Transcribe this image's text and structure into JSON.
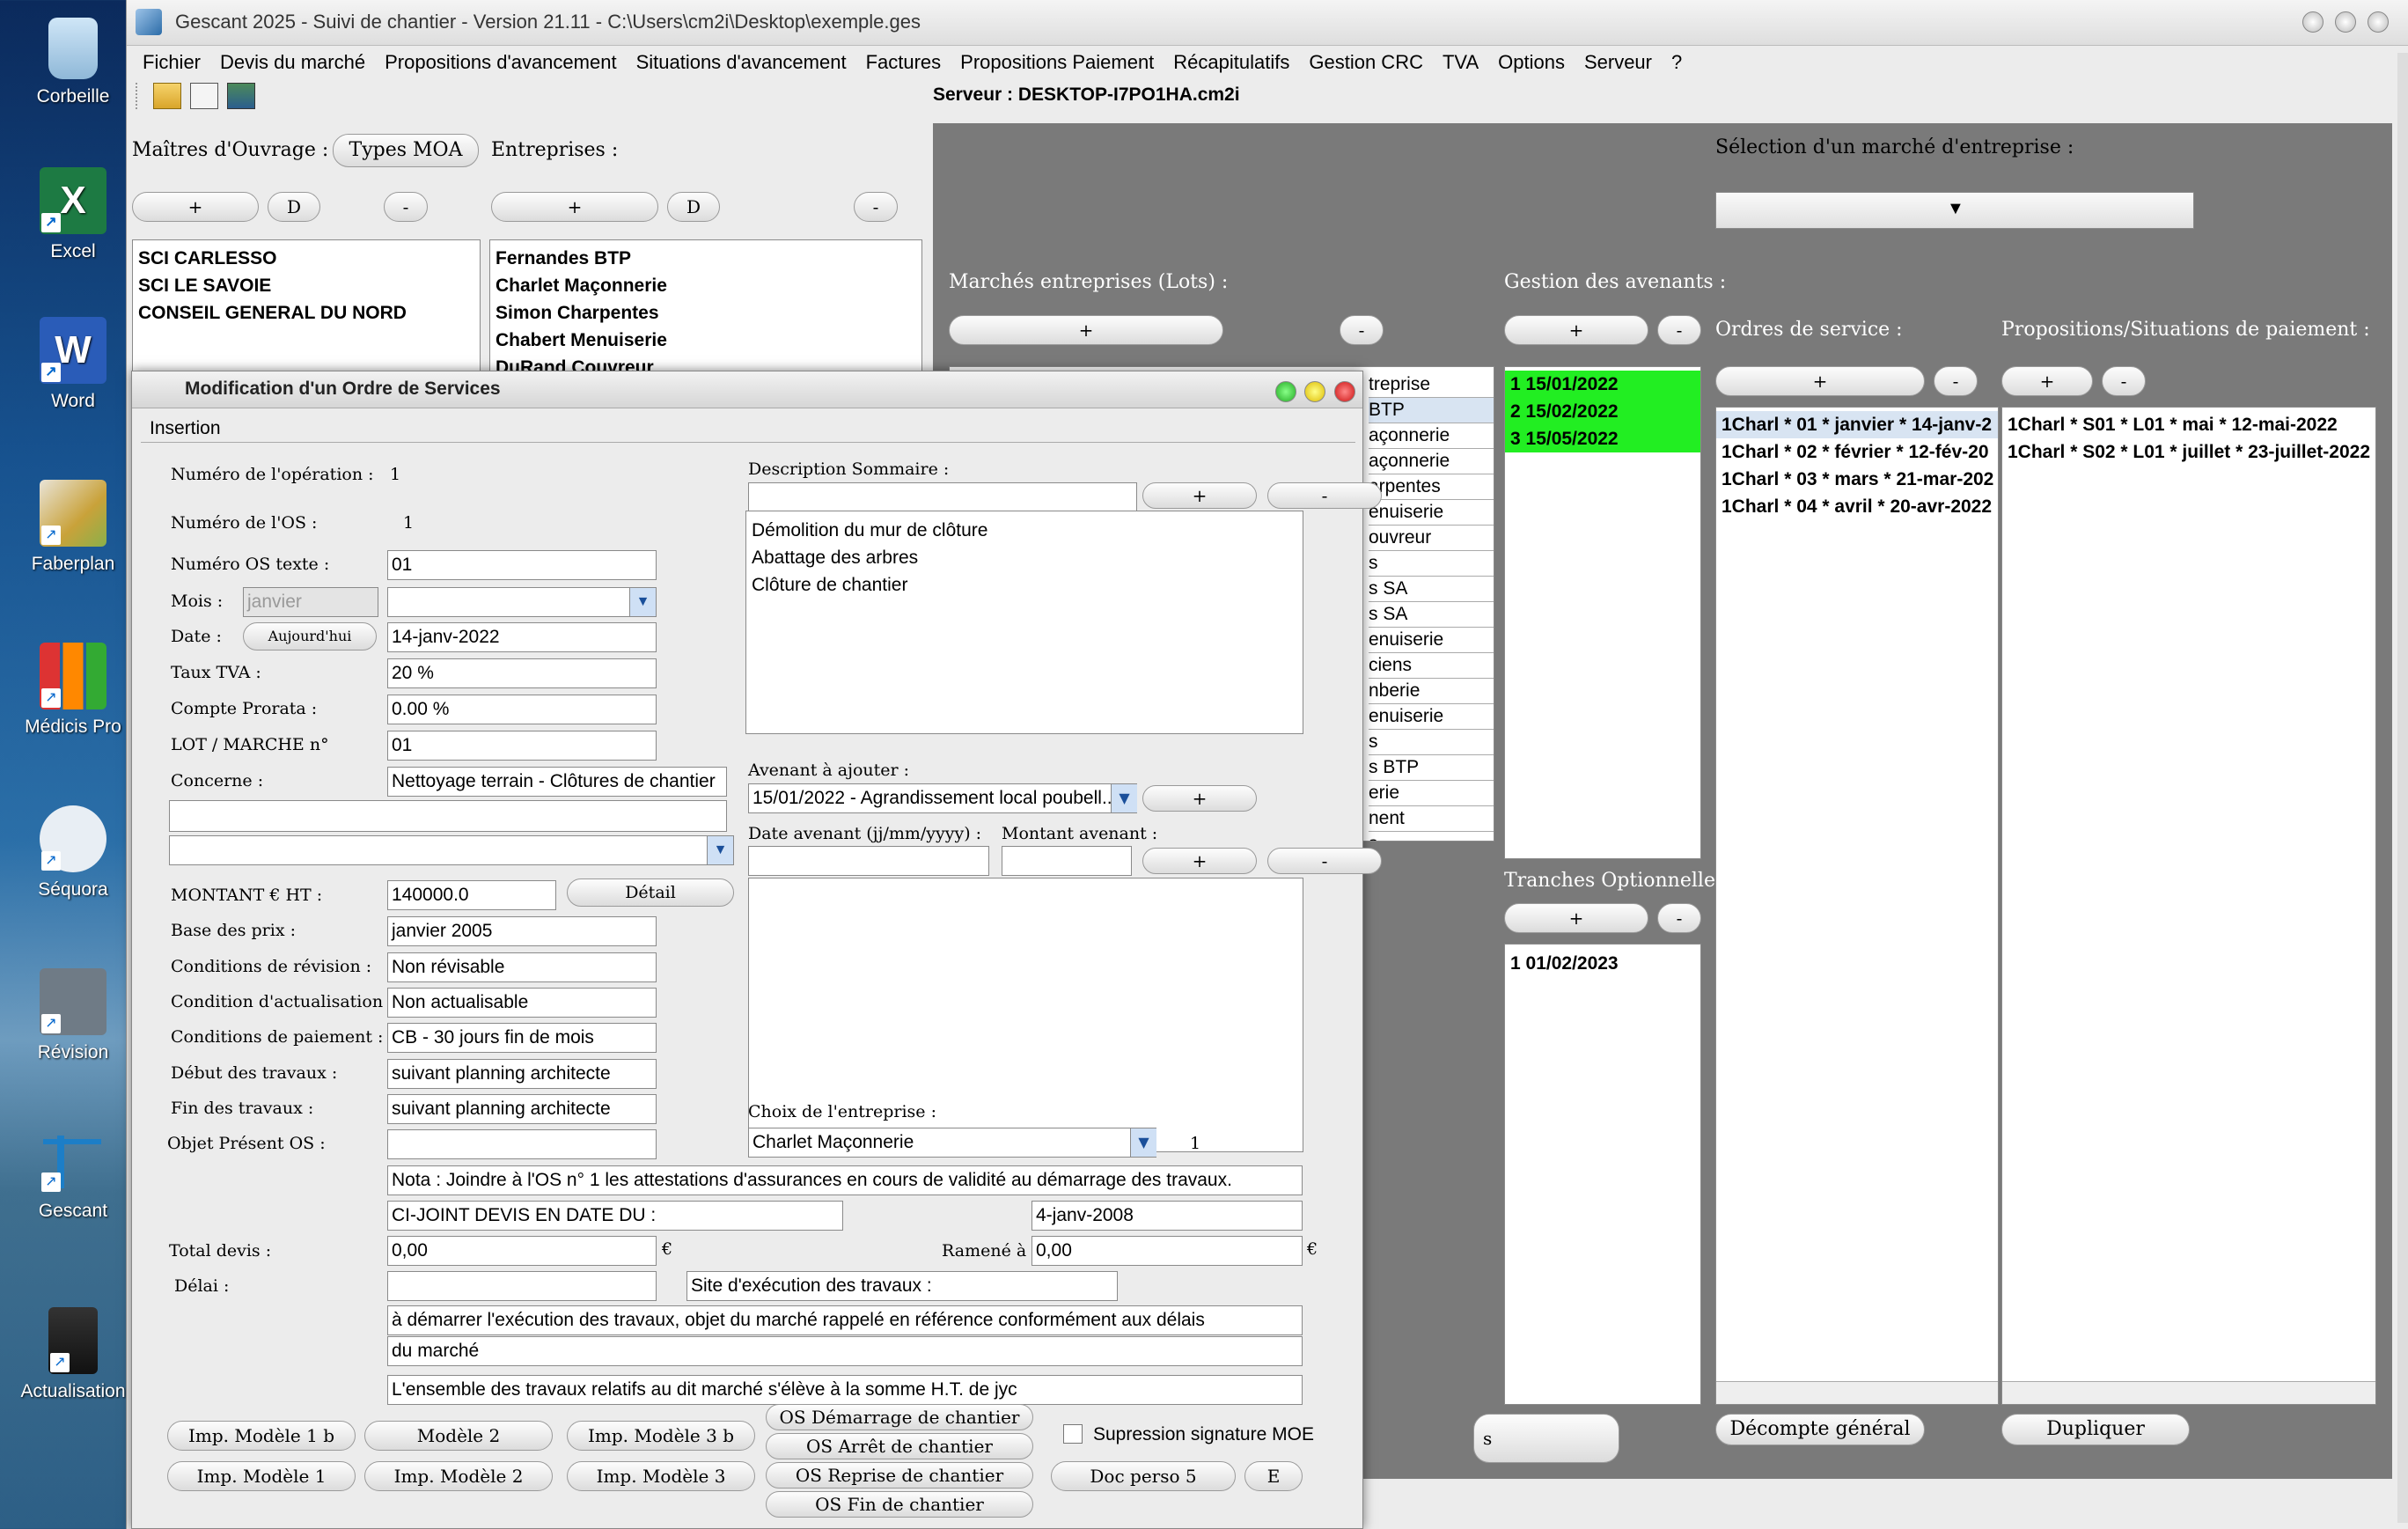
{
  "desktop": {
    "icons": [
      "Corbeille",
      "Excel",
      "Word",
      "Faberplan",
      "Médicis Pro",
      "Séquora",
      "Révision",
      "Gescant",
      "Actualisation"
    ]
  },
  "window": {
    "title": "Gescant 2025 - Suivi de chantier - Version 21.11 - C:\\Users\\cm2i\\Desktop\\exemple.ges",
    "server": "Serveur : DESKTOP-I7PO1HA.cm2i"
  },
  "menu": [
    "Fichier",
    "Devis du marché",
    "Propositions d'avancement",
    "Situations d'avancement",
    "Factures",
    "Propositions Paiement",
    "Récapitulatifs",
    "Gestion CRC",
    "TVA",
    "Options",
    "Serveur",
    "?"
  ],
  "left": {
    "moa_label": "Maîtres d'Ouvrage :",
    "types_moa": "Types MOA",
    "entreprises_label": "Entreprises :",
    "plus": "+",
    "d": "D",
    "minus": "-",
    "moa": [
      "SCI CARLESSO",
      "SCI LE SAVOIE",
      "CONSEIL GENERAL DU NORD"
    ],
    "entreprises": [
      "Fernandes BTP",
      "Charlet Maçonnerie",
      "Simon Charpentes",
      "Chabert Menuiserie",
      "DuRand Couvreur"
    ]
  },
  "right": {
    "selection_label": "Sélection d'un marché d'entreprise :",
    "marches_label": "Marchés entreprises (Lots) :",
    "avenants_label": "Gestion des avenants :",
    "os_label": "Ordres de service :",
    "props_label": "Propositions/Situations de paiement :",
    "tranches_label": "Tranches Optionnelles",
    "lots": [
      "treprise",
      " BTP",
      "açonnerie",
      "açonnerie",
      "arpentes",
      "enuiserie",
      "ouvreur",
      "s",
      "s SA",
      "s SA",
      "enuiserie",
      "ciens",
      "nberie",
      "enuiserie",
      "s",
      "s BTP",
      "erie",
      "nent",
      "s"
    ],
    "avenants": [
      "1 15/01/2022",
      "2 15/02/2022",
      "3 15/05/2022"
    ],
    "tranches": [
      "1 01/02/2023"
    ],
    "os": [
      "1Charl * 01 * janvier * 14-janv-2",
      "1Charl * 02 * février * 12-fév-20",
      "1Charl * 03 * mars * 21-mar-202",
      "1Charl * 04 * avril * 20-avr-2022"
    ],
    "props": [
      "1Charl * S01 * L01 * mai * 12-mai-2022",
      "1Charl * S02 * L01 * juillet * 23-juillet-2022"
    ],
    "decompte": "Décompte général",
    "dupliquer": "Dupliquer",
    "lot_btn_partial": "s"
  },
  "dialog": {
    "title": "Modification d'un Ordre de Services",
    "tab": "Insertion",
    "labels": {
      "num_op": "Numéro de l'opération :",
      "num_os": "Numéro de l'OS :",
      "num_os_txt": "Numéro OS texte :",
      "mois": "Mois :",
      "date": "Date :",
      "tva": "Taux TVA :",
      "prorata": "Compte Prorata :",
      "lot": "LOT / MARCHE n°",
      "concerne": "Concerne :",
      "montant": "MONTANT € HT :",
      "base": "Base des prix :",
      "revision": "Conditions de révision :",
      "actualisation": "Condition d'actualisation :",
      "paiement": "Conditions de paiement :",
      "debut": "Début des travaux :",
      "fin": "Fin des travaux :",
      "objet": "Objet Présent OS :",
      "total": "Total devis :",
      "ramene": "Ramené à :",
      "delai": "Délai :",
      "desc": "Description Sommaire :",
      "avenant": "Avenant à ajouter :",
      "date_av": "Date avenant (jj/mm/yyyy) :",
      "montant_av": "Montant avenant :",
      "choix": "Choix de l'entreprise :",
      "euro": "€",
      "site": "Site d'exécution des travaux :"
    },
    "values": {
      "num_op": "1",
      "num_os": "1",
      "num_os_txt": "01",
      "mois_placeholder": "janvier",
      "date": "14-janv-2022",
      "tva": "20 %",
      "prorata": "0.00 %",
      "lot": "01",
      "concerne": "Nettoyage terrain - Clôtures de chantier",
      "montant": "140000.0",
      "base": "janvier 2005",
      "revision": "Non révisable",
      "actualisation": "Non actualisable",
      "paiement": "CB - 30 jours fin de mois",
      "debut": "suivant planning architecte",
      "fin": "suivant planning architecte",
      "nota": "Nota : Joindre à l'OS n° 1 les attestations d'assurances en cours de validité au démarrage des travaux.",
      "cijoint": "CI-JOINT DEVIS EN DATE DU :",
      "cijoint_date": "4-janv-2008",
      "total": "0,00",
      "ramene": "0,00",
      "text1": "à démarrer l'exécution des travaux, objet du marché rappelé en référence conformément aux délais",
      "text2": "du marché",
      "text3": "L'ensemble des travaux relatifs au dit marché s'élève à la somme H.T. de jyc",
      "avenant": "15/01/2022 - Agrandissement local poubell...",
      "entreprise": "Charlet Maçonnerie",
      "entreprise_num": "1"
    },
    "desc_items": [
      "Démolition du mur de clôture",
      "Abattage des arbres",
      "Clôture de chantier"
    ],
    "buttons": {
      "aujourdhui": "Aujourd'hui",
      "detail": "Détail",
      "m1b": "Imp. Modèle 1 b",
      "m2": "Modèle 2",
      "m3b": "Imp. Modèle 3 b",
      "m1": "Imp. Modèle 1",
      "im2": "Imp. Modèle 2",
      "im3": "Imp. Modèle 3",
      "demarrage": "OS Démarrage de chantier",
      "arret": "OS Arrêt de chantier",
      "reprise": "OS Reprise de chantier",
      "finchantier": "OS Fin de chantier",
      "docperso": "Doc perso 5",
      "e": "E",
      "supp": "Supression signature MOE"
    }
  }
}
